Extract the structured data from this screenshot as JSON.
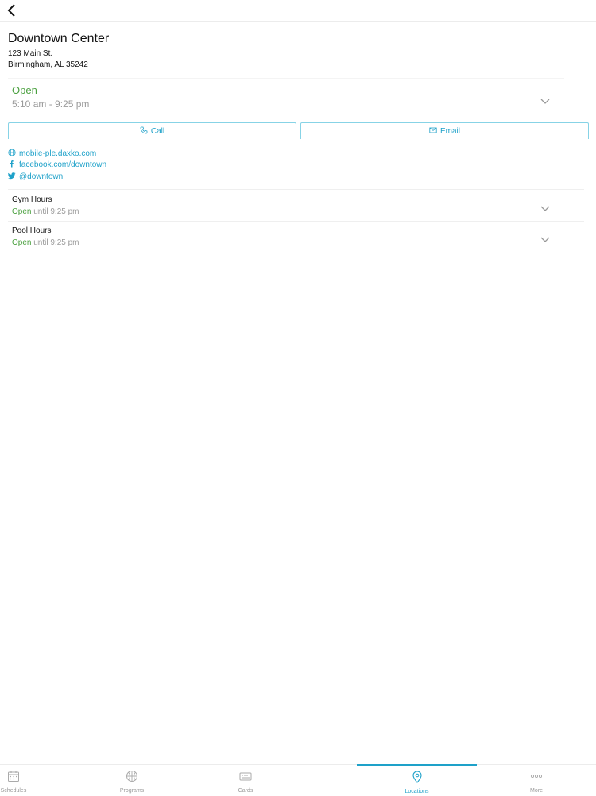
{
  "location": {
    "name": "Downtown Center",
    "address_line1": "123 Main St.",
    "address_line2": "Birmingham, AL 35242"
  },
  "status": {
    "label": "Open",
    "hours": "5:10 am - 9:25 pm"
  },
  "actions": {
    "call_label": "Call",
    "email_label": "Email"
  },
  "links": {
    "website": "mobile-ple.daxko.com",
    "facebook": "facebook.com/downtown",
    "twitter": "@downtown"
  },
  "hours": [
    {
      "name": "Gym Hours",
      "status": "Open",
      "detail": "until 9:25 pm"
    },
    {
      "name": "Pool Hours",
      "status": "Open",
      "detail": "until 9:25 pm"
    }
  ],
  "tabs": [
    {
      "label": "Schedules",
      "icon": "calendar-icon"
    },
    {
      "label": "Programs",
      "icon": "basketball-icon"
    },
    {
      "label": "Cards",
      "icon": "card-icon"
    },
    {
      "label": "Locations",
      "icon": "map-pin-icon",
      "active": true
    },
    {
      "label": "More",
      "icon": "more-icon"
    }
  ],
  "colors": {
    "accent": "#1ea1c9",
    "open_green": "#4aa03f",
    "muted": "#9a9a9a"
  }
}
